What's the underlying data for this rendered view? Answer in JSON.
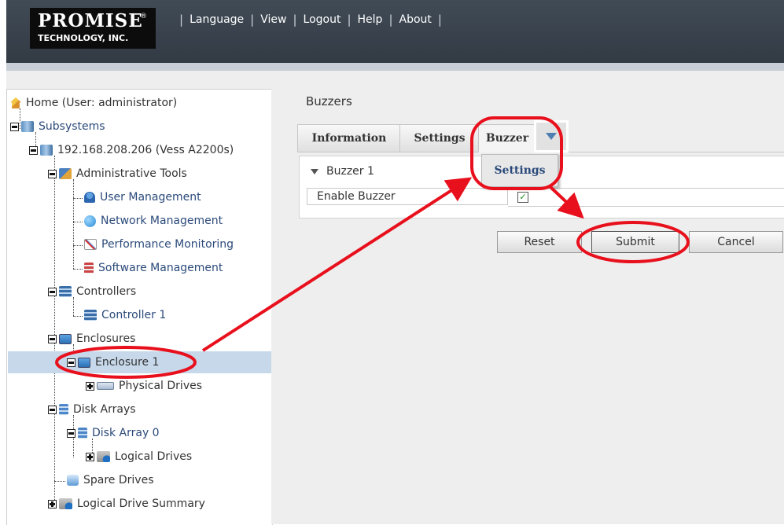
{
  "header": {
    "logo_line1": "PROMISE",
    "logo_reg": "®",
    "logo_line2": "TECHNOLOGY, INC.",
    "menu": [
      "Language",
      "View",
      "Logout",
      "Help",
      "About"
    ]
  },
  "tree": {
    "home": "Home (User: administrator)",
    "subsystems": "Subsystems",
    "subsystem_ip": "192.168.208.206 (Vess A2200s)",
    "admin_tools": "Administrative Tools",
    "user_mgmt": "User Management",
    "network_mgmt": "Network Management",
    "perf_mon": "Performance Monitoring",
    "software_mgmt": "Software Management",
    "controllers": "Controllers",
    "controller1": "Controller 1",
    "enclosures": "Enclosures",
    "enclosure1": "Enclosure 1",
    "physical_drives": "Physical Drives",
    "disk_arrays": "Disk Arrays",
    "disk_array0": "Disk Array 0",
    "logical_drives": "Logical Drives",
    "spare_drives": "Spare Drives",
    "logical_summary": "Logical Drive Summary"
  },
  "page": {
    "title": "Buzzers",
    "tabs": [
      "Information",
      "Settings",
      "Buzzer"
    ],
    "dropdown_item": "Settings",
    "section": "Buzzer 1",
    "field_label": "Enable Buzzer",
    "checkbox_checked": true,
    "check_mark": "✓",
    "buttons": {
      "reset": "Reset",
      "submit": "Submit",
      "cancel": "Cancel"
    }
  },
  "colors": {
    "header": "#3a434d",
    "highlight": "#e8101c",
    "selected_row": "#c6d8ea",
    "link": "#2b4a7a"
  }
}
